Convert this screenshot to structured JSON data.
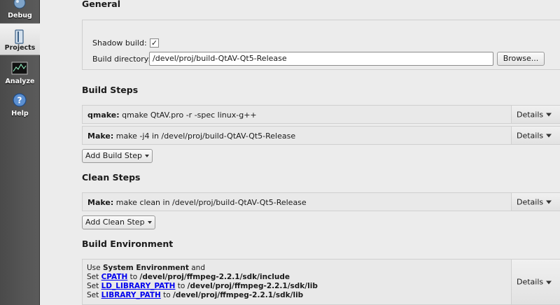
{
  "modebar": {
    "items": [
      {
        "label": "Debug",
        "icon": "debug-icon"
      },
      {
        "label": "Projects",
        "icon": "projects-icon"
      },
      {
        "label": "Analyze",
        "icon": "analyze-icon"
      },
      {
        "label": "Help",
        "icon": "help-icon"
      }
    ]
  },
  "general": {
    "title": "General",
    "shadow_build_label": "Shadow build:",
    "shadow_build_checked": "✓",
    "build_dir_label": "Build directory:",
    "build_dir_value": "/devel/proj/build-QtAV-Qt5-Release",
    "browse_label": "Browse..."
  },
  "build_steps": {
    "title": "Build Steps",
    "steps": [
      {
        "name": "qmake:",
        "detail": " qmake QtAV.pro -r -spec linux-g++"
      },
      {
        "name": "Make:",
        "detail": " make -j4 in /devel/proj/build-QtAV-Qt5-Release"
      }
    ],
    "add_label": "Add Build Step"
  },
  "clean_steps": {
    "title": "Clean Steps",
    "steps": [
      {
        "name": "Make:",
        "detail": " make clean in /devel/proj/build-QtAV-Qt5-Release"
      }
    ],
    "add_label": "Add Clean Step"
  },
  "details_label": "Details",
  "build_env": {
    "title": "Build Environment",
    "line1_prefix": "Use ",
    "line1_bold": "System Environment",
    "line1_suffix": " and",
    "lines": [
      {
        "set": "Set ",
        "var": "CPATH",
        "to": " to ",
        "value": "/devel/proj/ffmpeg-2.2.1/sdk/include"
      },
      {
        "set": "Set ",
        "var": "LD_LIBRARY_PATH",
        "to": " to ",
        "value": "/devel/proj/ffmpeg-2.2.1/sdk/lib"
      },
      {
        "set": "Set ",
        "var": "LIBRARY_PATH",
        "to": " to ",
        "value": "/devel/proj/ffmpeg-2.2.1/sdk/lib"
      }
    ]
  }
}
